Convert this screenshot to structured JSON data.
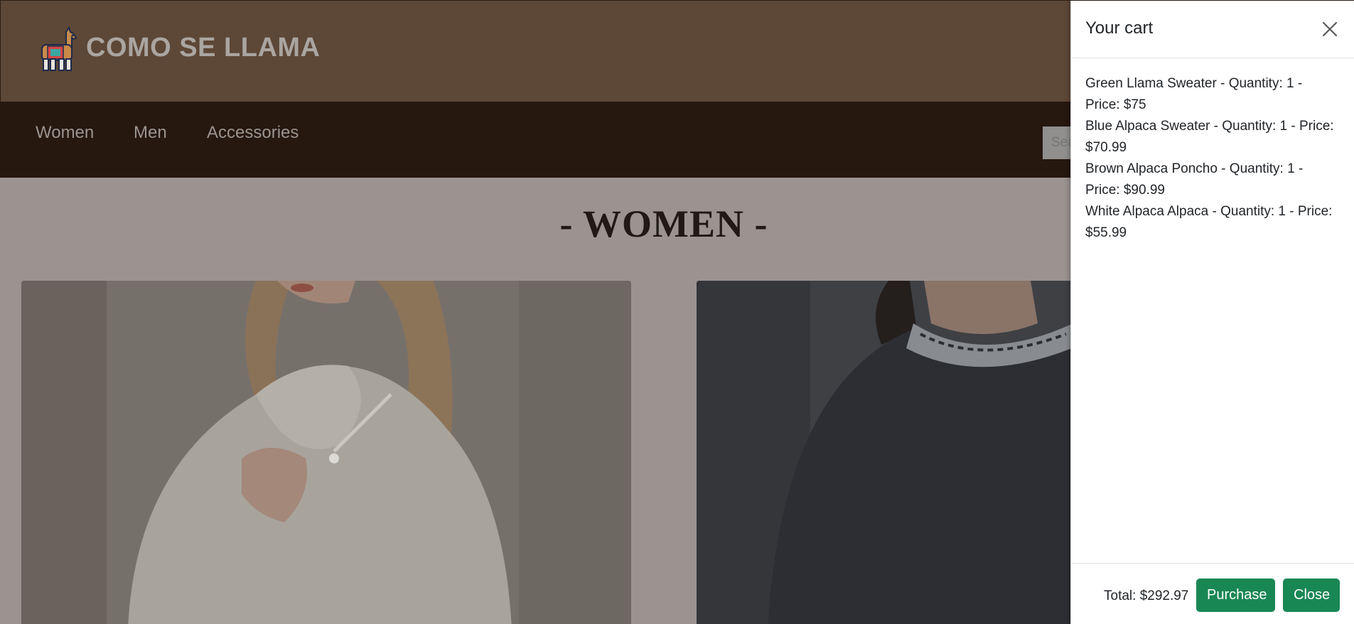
{
  "header": {
    "brand": "COMO SE LLAMA",
    "logo_icon": "llama-icon",
    "background": "#5d4737"
  },
  "nav": {
    "items": [
      {
        "label": "Women"
      },
      {
        "label": "Men"
      },
      {
        "label": "Accessories"
      }
    ],
    "search_placeholder": "Search",
    "background": "#26170f"
  },
  "main": {
    "section_title": "- WOMEN -",
    "products": [
      {
        "image": "woman-white-sweater-photo"
      },
      {
        "image": "woman-navy-sweater-photo"
      }
    ]
  },
  "cart": {
    "title": "Your cart",
    "close_icon": "close-icon",
    "items": [
      {
        "text": "Green Llama Sweater - Quantity: 1 - Price: $75"
      },
      {
        "text": "Blue Alpaca Sweater - Quantity: 1 - Price: $70.99"
      },
      {
        "text": "Brown Alpaca Poncho - Quantity: 1 - Price: $90.99"
      },
      {
        "text": "White Alpaca Alpaca - Quantity: 1 - Price: $55.99"
      }
    ],
    "total": "Total: $292.97",
    "purchase_label": "Purchase",
    "close_label": "Close",
    "button_color": "#198754"
  }
}
